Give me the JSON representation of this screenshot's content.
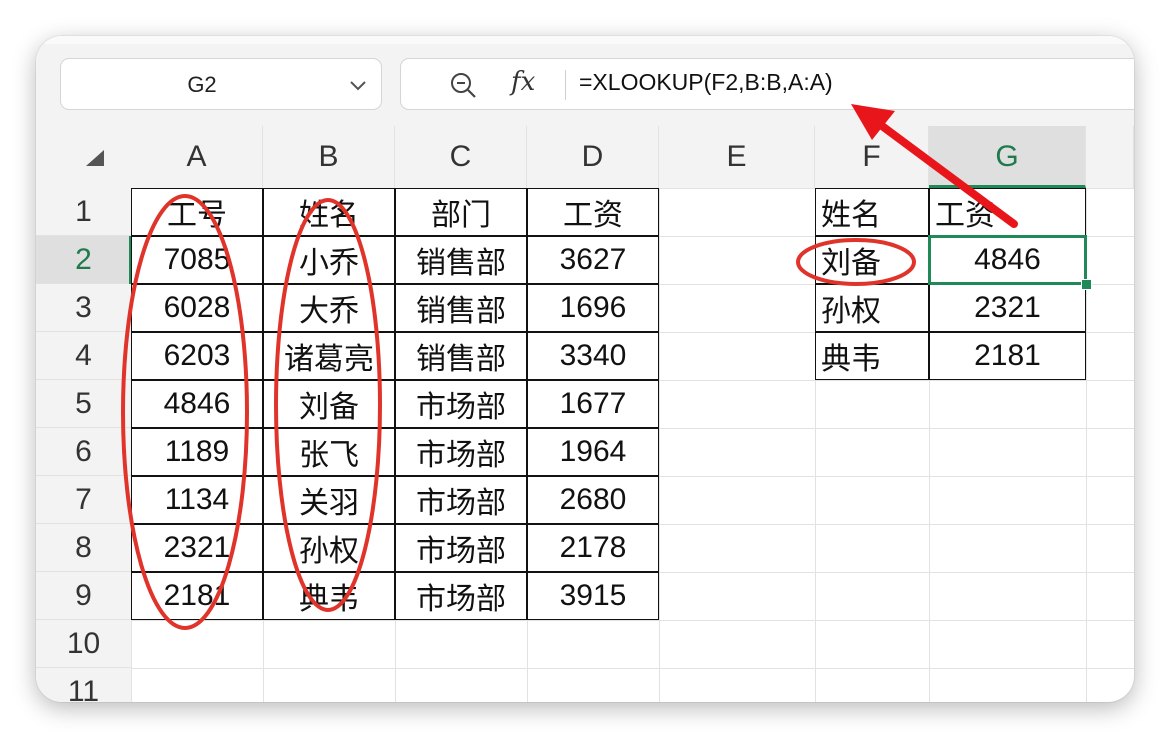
{
  "name_box": {
    "value": "G2"
  },
  "formula_bar": {
    "formula": "=XLOOKUP(F2,B:B,A:A)"
  },
  "columns": [
    "A",
    "B",
    "C",
    "D",
    "E",
    "F",
    "G"
  ],
  "rows": [
    "1",
    "2",
    "3",
    "4",
    "5",
    "6",
    "7",
    "8",
    "9",
    "10",
    "11"
  ],
  "active_cell": {
    "column": "G",
    "row": "2"
  },
  "table_main": {
    "headers": [
      "工号",
      "姓名",
      "部门",
      "工资"
    ],
    "rows": [
      [
        "7085",
        "小乔",
        "销售部",
        "3627"
      ],
      [
        "6028",
        "大乔",
        "销售部",
        "1696"
      ],
      [
        "6203",
        "诸葛亮",
        "销售部",
        "3340"
      ],
      [
        "4846",
        "刘备",
        "市场部",
        "1677"
      ],
      [
        "1189",
        "张飞",
        "市场部",
        "1964"
      ],
      [
        "1134",
        "关羽",
        "市场部",
        "2680"
      ],
      [
        "2321",
        "孙权",
        "市场部",
        "2178"
      ],
      [
        "2181",
        "典韦",
        "市场部",
        "3915"
      ]
    ]
  },
  "table_lookup": {
    "headers": [
      "姓名",
      "工资"
    ],
    "rows": [
      [
        "刘备",
        "4846"
      ],
      [
        "孙权",
        "2321"
      ],
      [
        "典韦",
        "2181"
      ]
    ]
  },
  "colors": {
    "annotation": "#e0342b",
    "arrow": "#e8161b",
    "selection": "#1f8a57"
  },
  "icons": [
    "chevron-down-icon",
    "zoom-icon",
    "fx-icon",
    "select-all-icon"
  ]
}
